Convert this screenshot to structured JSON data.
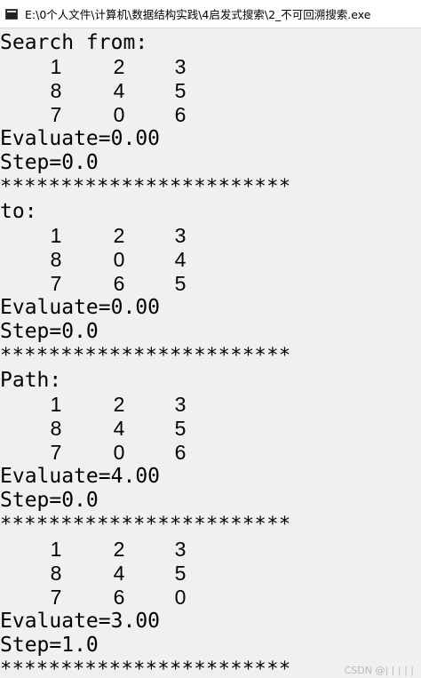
{
  "window": {
    "title": "E:\\0个人文件\\计算机\\数据结构实践\\4启发式搜索\\2_不可回溯搜索.exe",
    "icon": "console-app-icon"
  },
  "console": {
    "search_from": {
      "label": "Search from:",
      "grid": [
        [
          "1",
          "2",
          "3"
        ],
        [
          "8",
          "4",
          "5"
        ],
        [
          "7",
          "0",
          "6"
        ]
      ],
      "evaluate": "Evaluate=0.00",
      "step": "Step=0.0"
    },
    "separator": "************************",
    "to": {
      "label": "to:",
      "grid": [
        [
          "1",
          "2",
          "3"
        ],
        [
          "8",
          "0",
          "4"
        ],
        [
          "7",
          "6",
          "5"
        ]
      ],
      "evaluate": "Evaluate=0.00",
      "step": "Step=0.0"
    },
    "path": {
      "label": "Path:",
      "steps": [
        {
          "grid": [
            [
              "1",
              "2",
              "3"
            ],
            [
              "8",
              "4",
              "5"
            ],
            [
              "7",
              "0",
              "6"
            ]
          ],
          "evaluate": "Evaluate=4.00",
          "step": "Step=0.0"
        },
        {
          "grid": [
            [
              "1",
              "2",
              "3"
            ],
            [
              "8",
              "4",
              "5"
            ],
            [
              "7",
              "6",
              "0"
            ]
          ],
          "evaluate": "Evaluate=3.00",
          "step": "Step=1.0"
        }
      ]
    },
    "watermark": "CSDN @| | | | |"
  }
}
